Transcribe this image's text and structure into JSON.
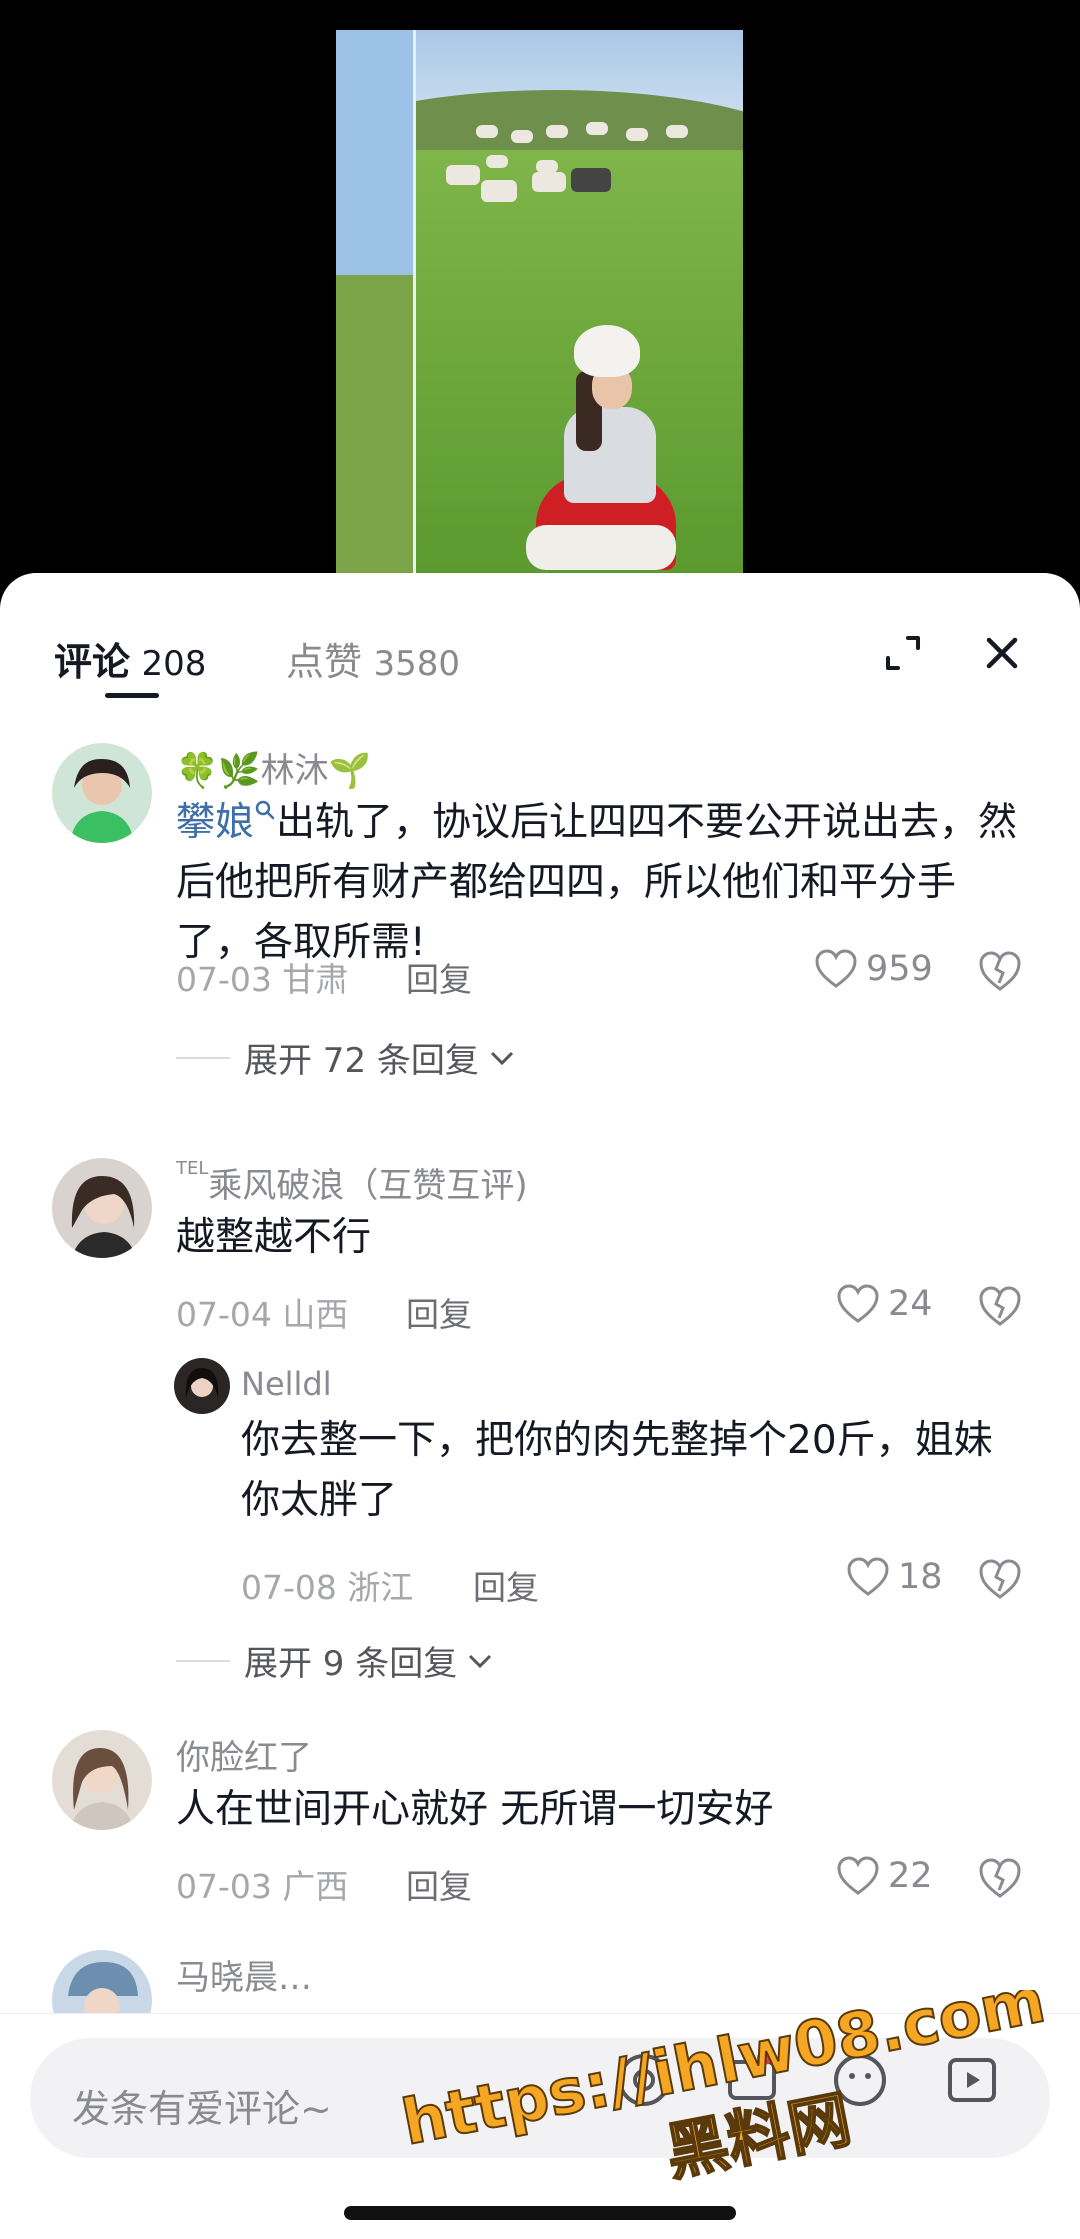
{
  "header": {
    "comments_label": "评论",
    "comments_count": "208",
    "likes_label": "点赞",
    "likes_count": "3580"
  },
  "comments": [
    {
      "name_prefix": "🍀🌿",
      "username": "林沐",
      "name_suffix": "🌱",
      "mention": "攀娘",
      "text_part2": "出轨了，协议后让四四不要公开说出去，然后他把所有财产都给四四，所以他们和平分手了，各取所需!",
      "date": "07-03",
      "location": "甘肃",
      "reply_label": "回复",
      "likes": "959",
      "expand_label": "展开 72 条回复"
    },
    {
      "tel_prefix": "TEL",
      "username": "乘风破浪（互赞互评)",
      "text": "越整越不行",
      "date": "07-04",
      "location": "山西",
      "reply_label": "回复",
      "likes": "24",
      "reply": {
        "username": "Nelldl",
        "text": "你去整一下，把你的肉先整掉个20斤，姐妹你太胖了",
        "date": "07-08",
        "location": "浙江",
        "reply_label": "回复",
        "likes": "18"
      },
      "expand_label": "展开 9 条回复"
    },
    {
      "username": "你脸红了",
      "text": "人在世间开心就好   无所谓一切安好",
      "date": "07-03",
      "location": "广西",
      "reply_label": "回复",
      "likes": "22"
    },
    {
      "username": "马晓晨…"
    }
  ],
  "input": {
    "placeholder": "发条有爱评论~"
  },
  "watermark": {
    "url": "https://ihlw08.com",
    "name": "黑料网"
  },
  "colors": {
    "mention": "#3f6fa8",
    "primary_text": "#161823",
    "secondary_text": "#8a8b91",
    "watermark": "#f5a623"
  }
}
